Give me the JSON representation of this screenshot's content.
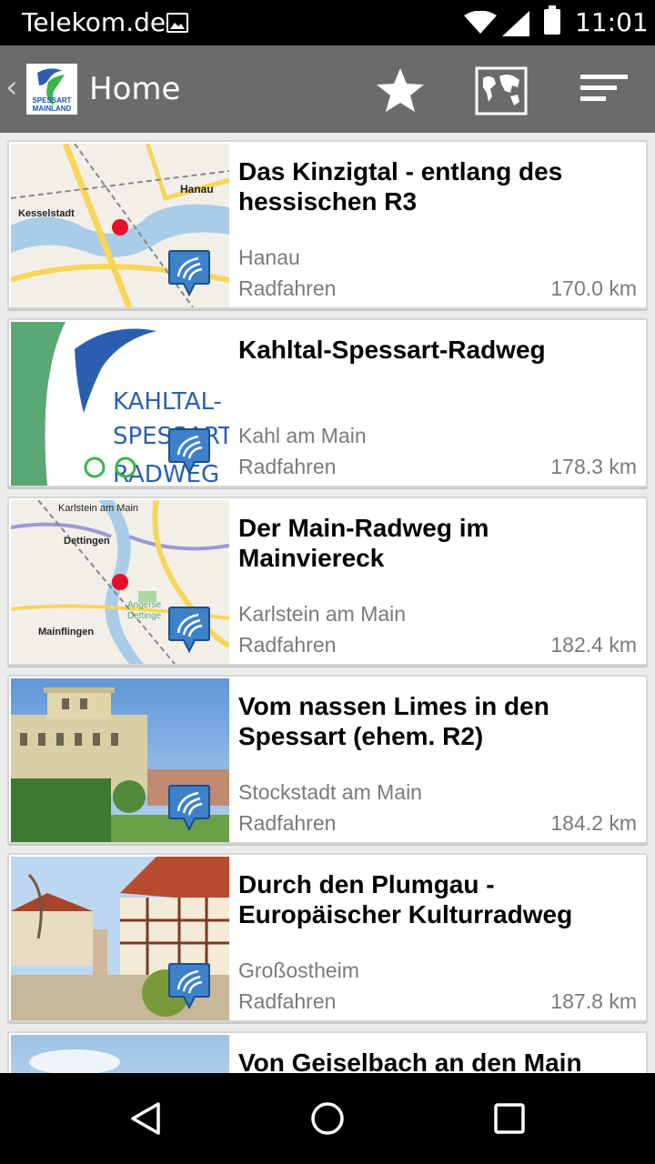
{
  "statusbar": {
    "carrier": "Telekom.de",
    "time": "11:01",
    "icons": [
      "image-icon",
      "wifi-icon",
      "signal-icon",
      "battery-icon"
    ]
  },
  "actionbar": {
    "title": "Home",
    "logo_text_top": "SPESSART",
    "logo_text_bottom": "MAINLAND",
    "icons": [
      "star-icon",
      "map-icon",
      "sort-icon"
    ],
    "background": "#6b6b6b"
  },
  "tours": [
    {
      "title": "Das Kinzigtal - entlang des hessischen R3",
      "place": "Hanau",
      "type": "Radfahren",
      "distance": "170.0 km",
      "thumb": "map",
      "map_labels": [
        "Kesselstadt",
        "Hanau"
      ]
    },
    {
      "title": "Kahltal-Spessart-Radweg",
      "place": "Kahl am Main",
      "type": "Radfahren",
      "distance": "178.3 km",
      "thumb": "logo",
      "logo_lines": [
        "KAHLTAL-",
        "SPESSART",
        "RADWEG"
      ]
    },
    {
      "title": "Der Main-Radweg im Mainviereck",
      "place": "Karlstein am Main",
      "type": "Radfahren",
      "distance": "182.4 km",
      "thumb": "map",
      "map_labels": [
        "Karlstein am Main",
        "Dettingen",
        "Mainflingen",
        "Angerse",
        "Dettinge"
      ]
    },
    {
      "title": "Vom nassen Limes in den Spessart (ehem. R2)",
      "place": "Stockstadt am Main",
      "type": "Radfahren",
      "distance": "184.2 km",
      "thumb": "photo-building"
    },
    {
      "title": "Durch den Plumgau - Europäischer Kulturradweg",
      "place": "Großostheim",
      "type": "Radfahren",
      "distance": "187.8 km",
      "thumb": "photo-town"
    },
    {
      "title": "Von Geiselbach an den Main",
      "place": "",
      "type": "",
      "distance": "",
      "thumb": "photo-sky"
    }
  ],
  "navbar": {
    "icons": [
      "back-triangle-icon",
      "home-circle-icon",
      "recents-square-icon"
    ]
  }
}
